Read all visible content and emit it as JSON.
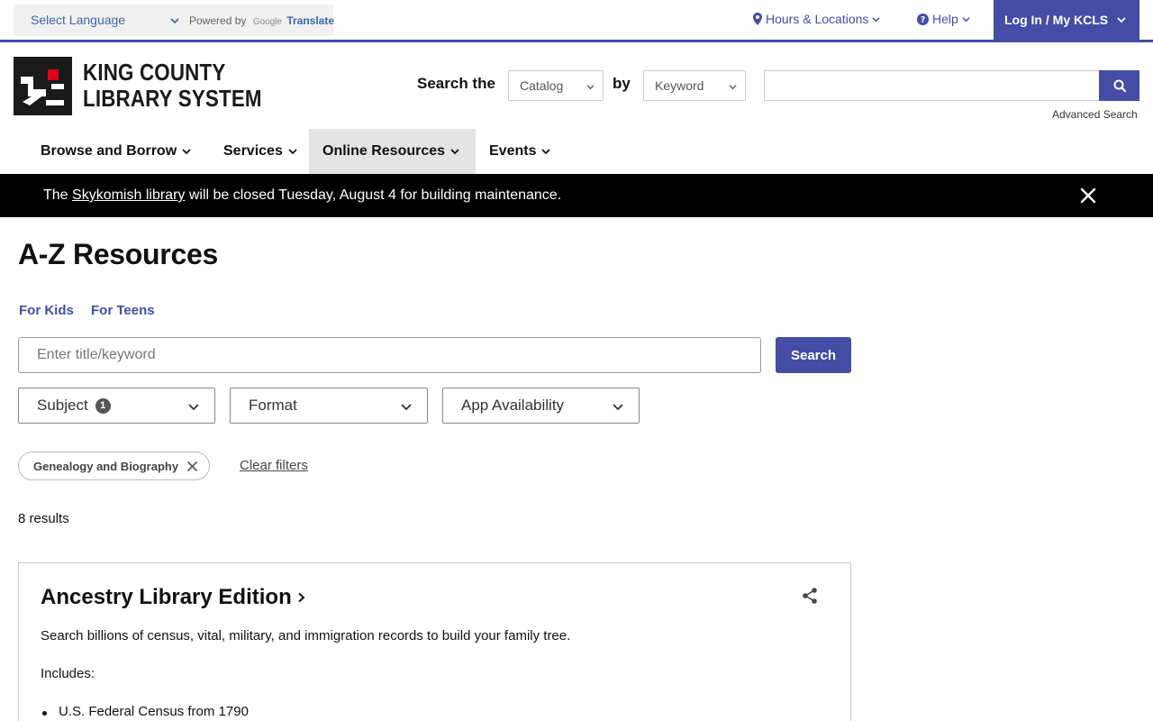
{
  "translate": {
    "select_label": "Select Language",
    "powered_by": "Powered by",
    "google": "Google",
    "translate": "Translate"
  },
  "utility": {
    "hours_locations": "Hours & Locations",
    "help": "Help",
    "login": "Log In / My KCLS"
  },
  "brand": {
    "line1": "KING COUNTY",
    "line2": "LIBRARY SYSTEM"
  },
  "header_search": {
    "label": "Search the",
    "scope_value": "Catalog",
    "by_label": "by",
    "type_value": "Keyword",
    "query_value": "",
    "advanced": "Advanced Search"
  },
  "nav": [
    {
      "label": "Browse and Borrow"
    },
    {
      "label": "Services"
    },
    {
      "label": "Online Resources"
    },
    {
      "label": "Events"
    }
  ],
  "alert": {
    "prefix": "The",
    "link": "Skykomish library",
    "suffix": "will be closed Tuesday, August 4 for building maintenance."
  },
  "page": {
    "title": "A-Z Resources",
    "audience_links": [
      "For Kids",
      "For Teens"
    ],
    "search_placeholder": "Enter title/keyword",
    "search_value": "",
    "search_button": "Search"
  },
  "filters": {
    "subject": {
      "label": "Subject",
      "count": "1"
    },
    "format": {
      "label": "Format"
    },
    "app": {
      "label": "App Availability"
    },
    "active_chip": "Genealogy and Biography",
    "clear": "Clear filters"
  },
  "results": {
    "count_text": "8 results",
    "items": [
      {
        "title": "Ancestry Library Edition",
        "description": "Search billions of census, vital, military, and immigration records to build your family tree.",
        "includes_label": "Includes:",
        "includes": [
          "U.S. Federal Census from 1790"
        ]
      }
    ]
  },
  "colors": {
    "accent": "#434da5",
    "alert_bg": "#000000"
  }
}
